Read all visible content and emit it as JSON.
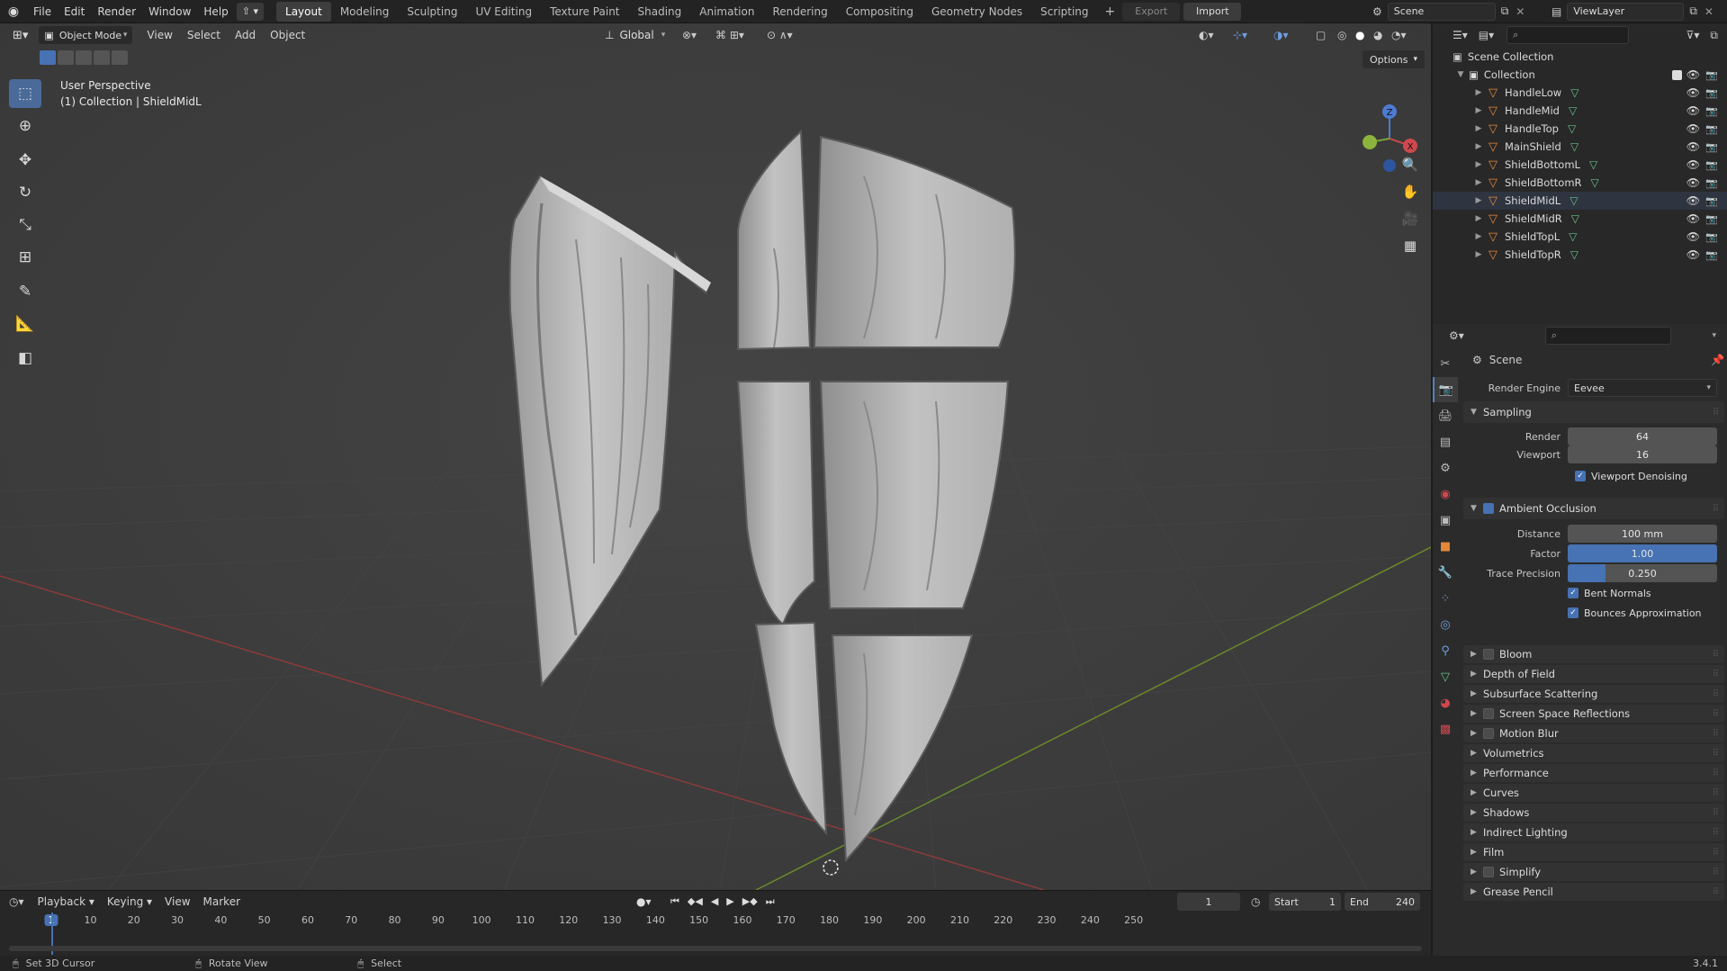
{
  "topbar": {
    "menus": [
      "File",
      "Edit",
      "Render",
      "Window",
      "Help"
    ],
    "workspaces": [
      "Layout",
      "Modeling",
      "Sculpting",
      "UV Editing",
      "Texture Paint",
      "Shading",
      "Animation",
      "Rendering",
      "Compositing",
      "Geometry Nodes",
      "Scripting"
    ],
    "active_workspace": "Layout",
    "export_label": "Export",
    "import_label": "Import",
    "scene_name": "Scene",
    "view_layer": "ViewLayer"
  },
  "viewport": {
    "mode": "Object Mode",
    "menus": [
      "View",
      "Select",
      "Add",
      "Object"
    ],
    "orientation": "Global",
    "options_label": "Options",
    "perspective_label": "User Perspective",
    "collection_label": "(1) Collection | ShieldMidL",
    "gizmo_axes": [
      "X",
      "Y",
      "Z"
    ],
    "tools": [
      "select-box-icon",
      "cursor-icon",
      "move-icon",
      "rotate-icon",
      "scale-icon",
      "transform-icon",
      "annotate-icon",
      "measure-icon",
      "add-cube-icon"
    ]
  },
  "outliner": {
    "root": "Scene Collection",
    "collection": "Collection",
    "objects": [
      "HandleLow",
      "HandleMid",
      "HandleTop",
      "MainShield",
      "ShieldBottomL",
      "ShieldBottomR",
      "ShieldMidL",
      "ShieldMidR",
      "ShieldTopL",
      "ShieldTopR"
    ],
    "selected": "ShieldMidL"
  },
  "properties": {
    "context": "Scene",
    "render_engine_label": "Render Engine",
    "render_engine": "Eevee",
    "sampling": {
      "title": "Sampling",
      "render_label": "Render",
      "render_value": "64",
      "viewport_label": "Viewport",
      "viewport_value": "16",
      "denoise_label": "Viewport Denoising"
    },
    "ao": {
      "title": "Ambient Occlusion",
      "distance_label": "Distance",
      "distance_value": "100 mm",
      "factor_label": "Factor",
      "factor_value": "1.00",
      "factor_fraction": 1.0,
      "trace_label": "Trace Precision",
      "trace_value": "0.250",
      "trace_fraction": 0.25,
      "bent_normals": "Bent Normals",
      "bounces": "Bounces Approximation"
    },
    "sections": [
      {
        "title": "Bloom",
        "checkbox": true
      },
      {
        "title": "Depth of Field",
        "checkbox": false
      },
      {
        "title": "Subsurface Scattering",
        "checkbox": false
      },
      {
        "title": "Screen Space Reflections",
        "checkbox": true
      },
      {
        "title": "Motion Blur",
        "checkbox": true
      },
      {
        "title": "Volumetrics",
        "checkbox": false
      },
      {
        "title": "Performance",
        "checkbox": false
      },
      {
        "title": "Curves",
        "checkbox": false
      },
      {
        "title": "Shadows",
        "checkbox": false
      },
      {
        "title": "Indirect Lighting",
        "checkbox": false
      },
      {
        "title": "Film",
        "checkbox": false
      },
      {
        "title": "Simplify",
        "checkbox": true
      },
      {
        "title": "Grease Pencil",
        "checkbox": false
      }
    ]
  },
  "timeline": {
    "menus": [
      "Playback",
      "Keying",
      "View",
      "Marker"
    ],
    "current_frame": "1",
    "start_label": "Start",
    "start_value": "1",
    "end_label": "End",
    "end_value": "240",
    "ruler": [
      "1",
      "10",
      "20",
      "30",
      "40",
      "50",
      "60",
      "70",
      "80",
      "90",
      "100",
      "110",
      "120",
      "130",
      "140",
      "150",
      "160",
      "170",
      "180",
      "190",
      "200",
      "210",
      "220",
      "230",
      "240",
      "250"
    ]
  },
  "statusbar": {
    "hints": [
      "Set 3D Cursor",
      "Rotate View",
      "Select"
    ],
    "version": "3.4.1"
  }
}
